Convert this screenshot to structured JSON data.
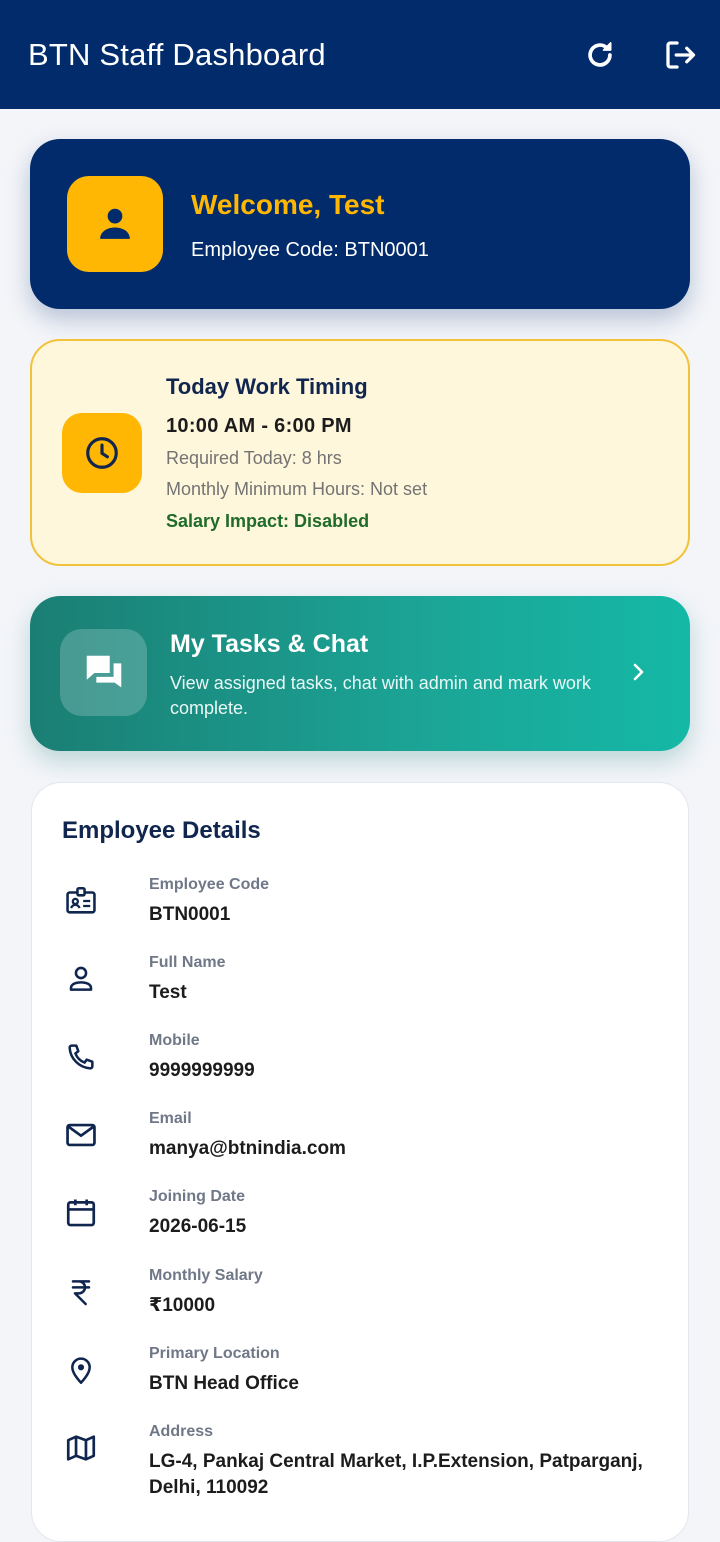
{
  "appbar": {
    "title": "BTN Staff Dashboard",
    "refresh_icon": "refresh-icon",
    "logout_icon": "logout-icon"
  },
  "welcome": {
    "title": "Welcome, Test",
    "code": "Employee Code: BTN0001",
    "avatar_icon": "person-icon"
  },
  "timing": {
    "title": "Today Work Timing",
    "hours": "10:00 AM - 6:00 PM",
    "required": "Required Today: 8 hrs",
    "monthly": "Monthly Minimum Hours: Not set",
    "impact": "Salary Impact: Disabled",
    "icon": "clock-icon"
  },
  "tasks": {
    "title": "My Tasks & Chat",
    "description": "View assigned tasks, chat with admin and mark work complete.",
    "icon": "chat-icon"
  },
  "details": {
    "title": "Employee Details",
    "rows": [
      {
        "label": "Employee Code",
        "value": "BTN0001",
        "icon": "badge-icon"
      },
      {
        "label": "Full Name",
        "value": "Test",
        "icon": "person-outline-icon"
      },
      {
        "label": "Mobile",
        "value": "9999999999",
        "icon": "phone-icon"
      },
      {
        "label": "Email",
        "value": "manya@btnindia.com",
        "icon": "mail-icon"
      },
      {
        "label": "Joining Date",
        "value": "2026-06-15",
        "icon": "calendar-icon"
      },
      {
        "label": "Monthly Salary",
        "value": "₹10000",
        "icon": "rupee-icon"
      },
      {
        "label": "Primary Location",
        "value": "BTN Head Office",
        "icon": "location-pin-icon"
      },
      {
        "label": "Address",
        "value": "LG-4, Pankaj Central Market, I.P.Extension, Patparganj, Delhi, 110092",
        "icon": "map-icon"
      }
    ]
  },
  "colors": {
    "primary": "#022b6b",
    "accent": "#ffb703",
    "teal": "#1ba596",
    "success": "#1f6b2a"
  }
}
